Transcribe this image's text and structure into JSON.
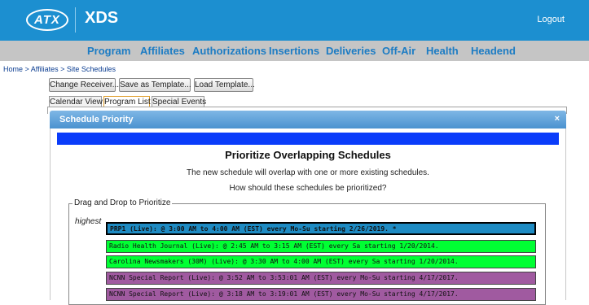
{
  "header": {
    "logo_text": "ATX",
    "app_title": "XDS",
    "logout_label": "Logout",
    "brand_color": "#1c8fd0"
  },
  "nav": {
    "items": [
      {
        "label": "Program"
      },
      {
        "label": "Affiliates"
      },
      {
        "label": "Authorizations"
      },
      {
        "label": "Insertions"
      },
      {
        "label": "Deliveries"
      },
      {
        "label": "Off-Air"
      },
      {
        "label": "Health"
      },
      {
        "label": "Headend"
      }
    ]
  },
  "breadcrumb": {
    "home": "Home",
    "affiliates": "Affiliates",
    "current": "Site Schedules",
    "separator": " > "
  },
  "toolbar": {
    "change_receiver": "Change Receiver...",
    "save_template": "Save as Template...",
    "load_template": "Load Template..."
  },
  "tabs": [
    {
      "label": "Calendar View",
      "active": false
    },
    {
      "label": "Program List",
      "active": true
    },
    {
      "label": "Special Events",
      "active": false
    }
  ],
  "modal": {
    "title": "Schedule Priority",
    "close_symbol": "×",
    "heading": "Prioritize Overlapping Schedules",
    "line1": "The new schedule will overlap with one or more existing schedules.",
    "line2": "How should these schedules be prioritized?",
    "fieldset_legend": "Drag and Drop to Prioritize",
    "highest_label": "highest",
    "schedules": [
      {
        "text": "PRP1 (Live): @ 3:00 AM to 4:00 AM (EST) every Mo-Su starting 2/26/2019. *",
        "color": "#1e8bc3",
        "selected": true
      },
      {
        "text": "Radio Health Journal (Live): @ 2:45 AM to 3:15 AM (EST) every Sa starting 1/20/2014.",
        "color": "#00ff33",
        "selected": false
      },
      {
        "text": "Carolina Newsmakers (30M) (Live): @ 3:30 AM to 4:00 AM (EST) every Sa starting 1/20/2014.",
        "color": "#00ff33",
        "selected": false
      },
      {
        "text": "NCNN Special Report (Live): @ 3:52 AM to 3:53:01 AM (EST) every Mo-Su starting 4/17/2017.",
        "color": "#a05aa0",
        "selected": false
      },
      {
        "text": "NCNN Special Report (Live): @ 3:18 AM to 3:19:01 AM (EST) every Mo-Su starting 4/17/2017.",
        "color": "#a05aa0",
        "selected": false
      }
    ]
  }
}
